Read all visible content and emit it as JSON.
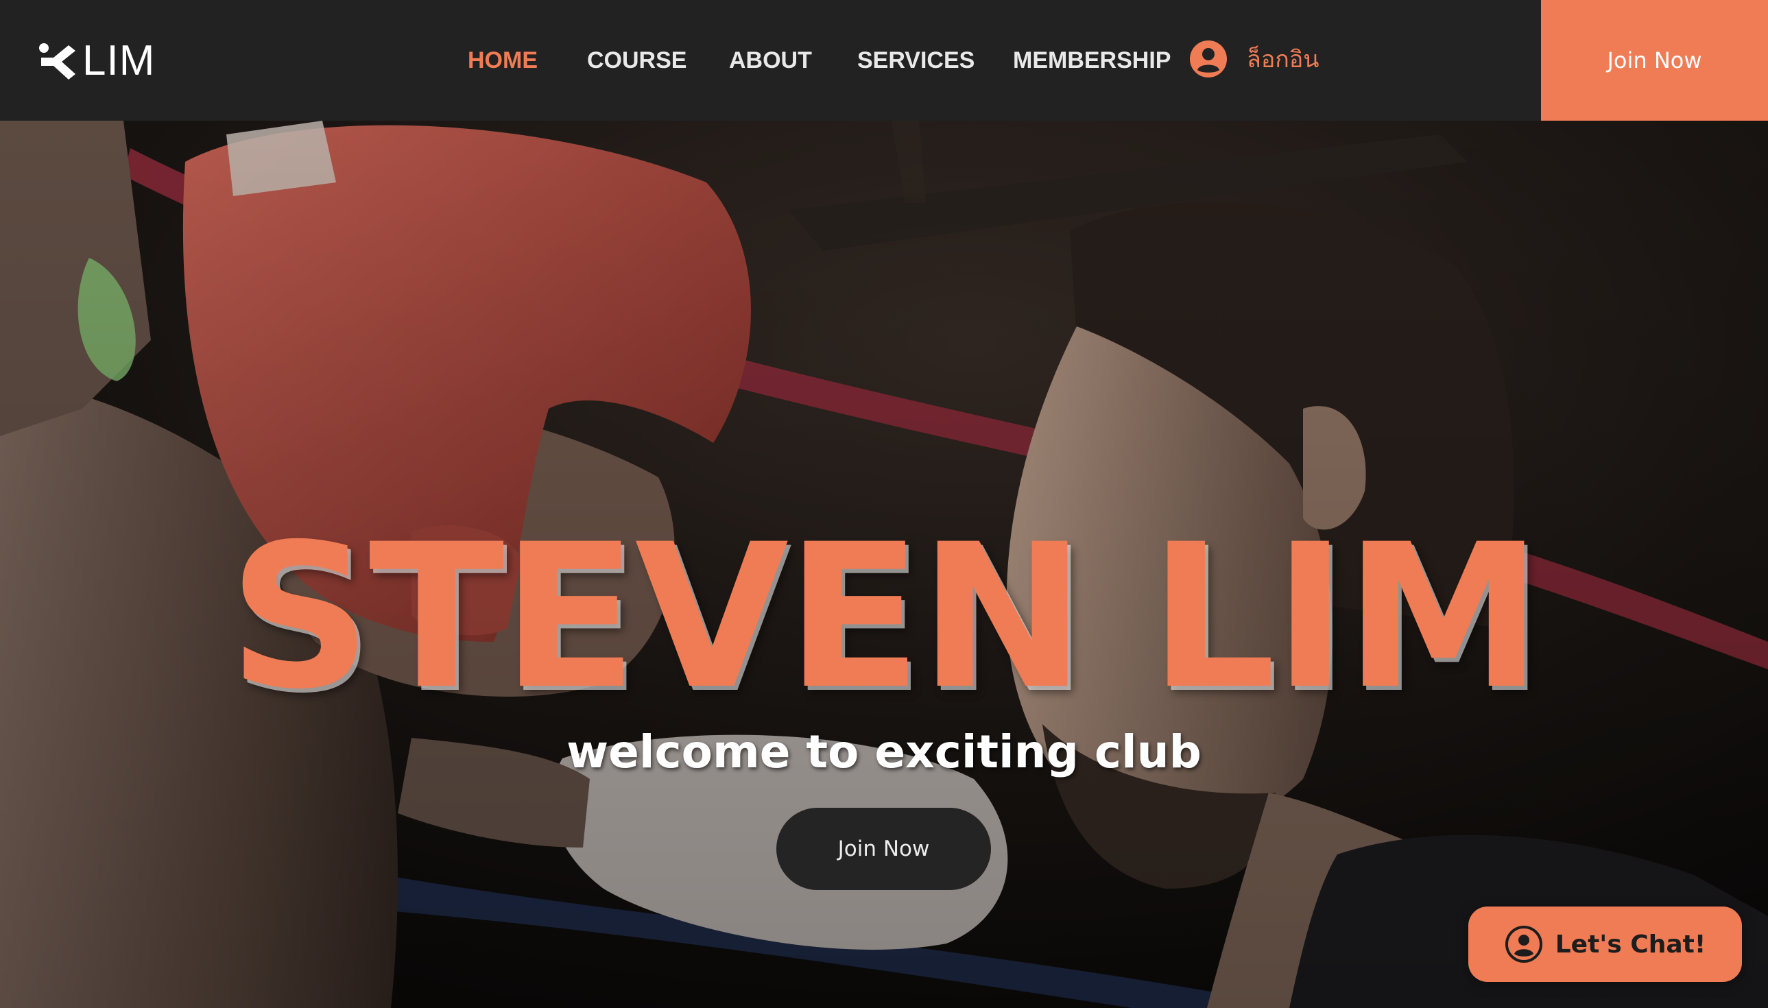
{
  "brand": {
    "logo_text": "LIM",
    "accent_color": "#f07c55",
    "header_bg": "#222222"
  },
  "nav": {
    "items": [
      {
        "label": "HOME",
        "active": true
      },
      {
        "label": "COURSE",
        "active": false
      },
      {
        "label": "ABOUT",
        "active": false
      },
      {
        "label": "SERVICES",
        "active": false
      },
      {
        "label": "MEMBERSHIP",
        "active": false
      }
    ],
    "login_label": "ล็อกอิน",
    "login_icon": "user-circle-icon",
    "join_label": "Join Now"
  },
  "hero": {
    "headline": "STEVEN LIM",
    "tagline": "welcome to exciting club",
    "cta_label": "Join Now"
  },
  "chat": {
    "label": "Let's Chat!",
    "icon": "user-circle-icon"
  }
}
